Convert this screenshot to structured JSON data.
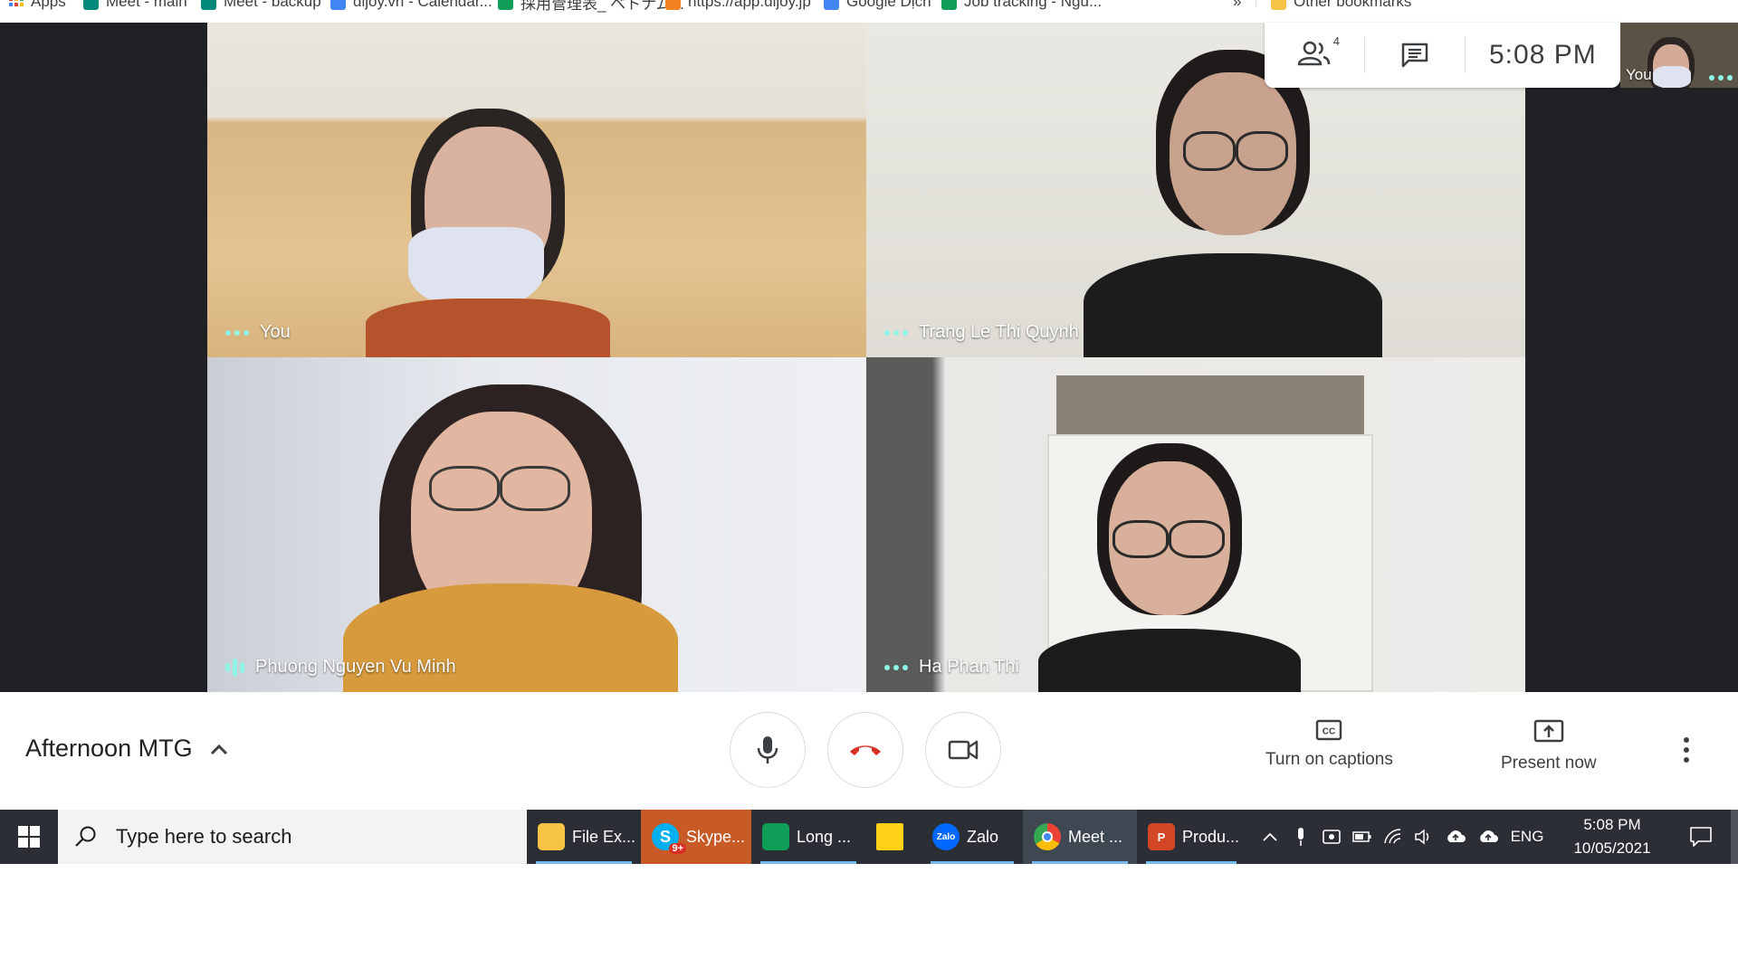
{
  "browser": {
    "bookmarks": [
      {
        "label": "Apps",
        "icon": "apps-grid-icon",
        "color": "#ea4335"
      },
      {
        "label": "Meet - main",
        "icon": "meet-icon",
        "color": "#00897b"
      },
      {
        "label": "Meet - backup",
        "icon": "meet-icon",
        "color": "#00897b"
      },
      {
        "label": "dijoy.vn - Calendar...",
        "icon": "calendar-icon",
        "color": "#4285f4"
      },
      {
        "label": "採用管理表_ ベトナム...",
        "icon": "sheets-icon",
        "color": "#0f9d58"
      },
      {
        "label": "https://app.dijoy.jp",
        "icon": "site-icon",
        "color": "#f4811f"
      },
      {
        "label": "Google Dịch",
        "icon": "translate-icon",
        "color": "#4285f4"
      },
      {
        "label": "Job tracking - Ngu...",
        "icon": "sheets-icon",
        "color": "#0f9d58"
      },
      {
        "label": "Other bookmarks",
        "icon": "folder-icon",
        "color": "#f6c344"
      }
    ],
    "overflow_label": "»"
  },
  "meet": {
    "participant_count": "4",
    "clock": "5:08 PM",
    "self_view_label": "You",
    "tiles": [
      {
        "name": "You",
        "status": "dots"
      },
      {
        "name": "Trang Le Thi Quynh",
        "status": "dots"
      },
      {
        "name": "Phuong Nguyen Vu Minh",
        "status": "speaking"
      },
      {
        "name": "Ha Phan Thi",
        "status": "dots"
      }
    ],
    "meeting_title": "Afternoon MTG",
    "captions_label": "Turn on captions",
    "present_label": "Present now",
    "colors": {
      "accent": "#8ff5e6",
      "hangup": "#d93025",
      "stage": "#202124"
    }
  },
  "taskbar": {
    "search_placeholder": "Type here to search",
    "apps": [
      {
        "label": "File Ex...",
        "icon": "file-explorer-icon",
        "color": "#f6c344"
      },
      {
        "label": "Skype...",
        "icon": "skype-icon",
        "color": "#00aff0",
        "badge": "9+"
      },
      {
        "label": "Long ...",
        "icon": "sheets-icon",
        "color": "#0f9d58"
      },
      {
        "label": "",
        "icon": "sticky-notes-icon",
        "color": "#fcd116"
      },
      {
        "label": "Zalo",
        "icon": "zalo-icon",
        "color": "#0068ff",
        "icon_text": "Zalo"
      },
      {
        "label": "Meet ...",
        "icon": "chrome-icon",
        "color": "#4285f4"
      },
      {
        "label": "Produ...",
        "icon": "powerpoint-icon",
        "color": "#d24726",
        "icon_text": "P"
      }
    ],
    "tray": {
      "lang": "ENG",
      "time": "5:08 PM",
      "date": "10/05/2021"
    }
  }
}
